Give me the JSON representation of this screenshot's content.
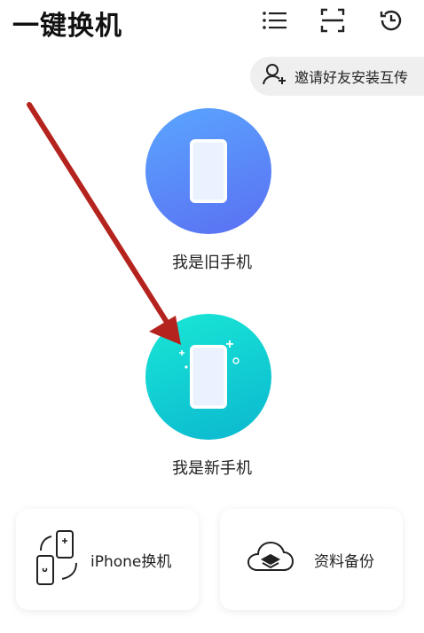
{
  "header": {
    "title": "一键换机",
    "icons": [
      "list-icon",
      "scan-icon",
      "history-icon"
    ]
  },
  "invite": {
    "label": "邀请好友安装互传",
    "icon": "add-user-icon"
  },
  "options": {
    "old_phone": {
      "label": "我是旧手机"
    },
    "new_phone": {
      "label": "我是新手机"
    }
  },
  "cards": {
    "iphone": {
      "label": "iPhone换机",
      "icon": "phone-swap-icon"
    },
    "backup": {
      "label": "资料备份",
      "icon": "cloud-layers-icon"
    }
  },
  "colors": {
    "old_gradient_start": "#5aa6ff",
    "old_gradient_end": "#5a6ff2",
    "new_gradient_start": "#19e7d6",
    "new_gradient_end": "#0bb7cf",
    "annotation_arrow": "#b5231e"
  }
}
